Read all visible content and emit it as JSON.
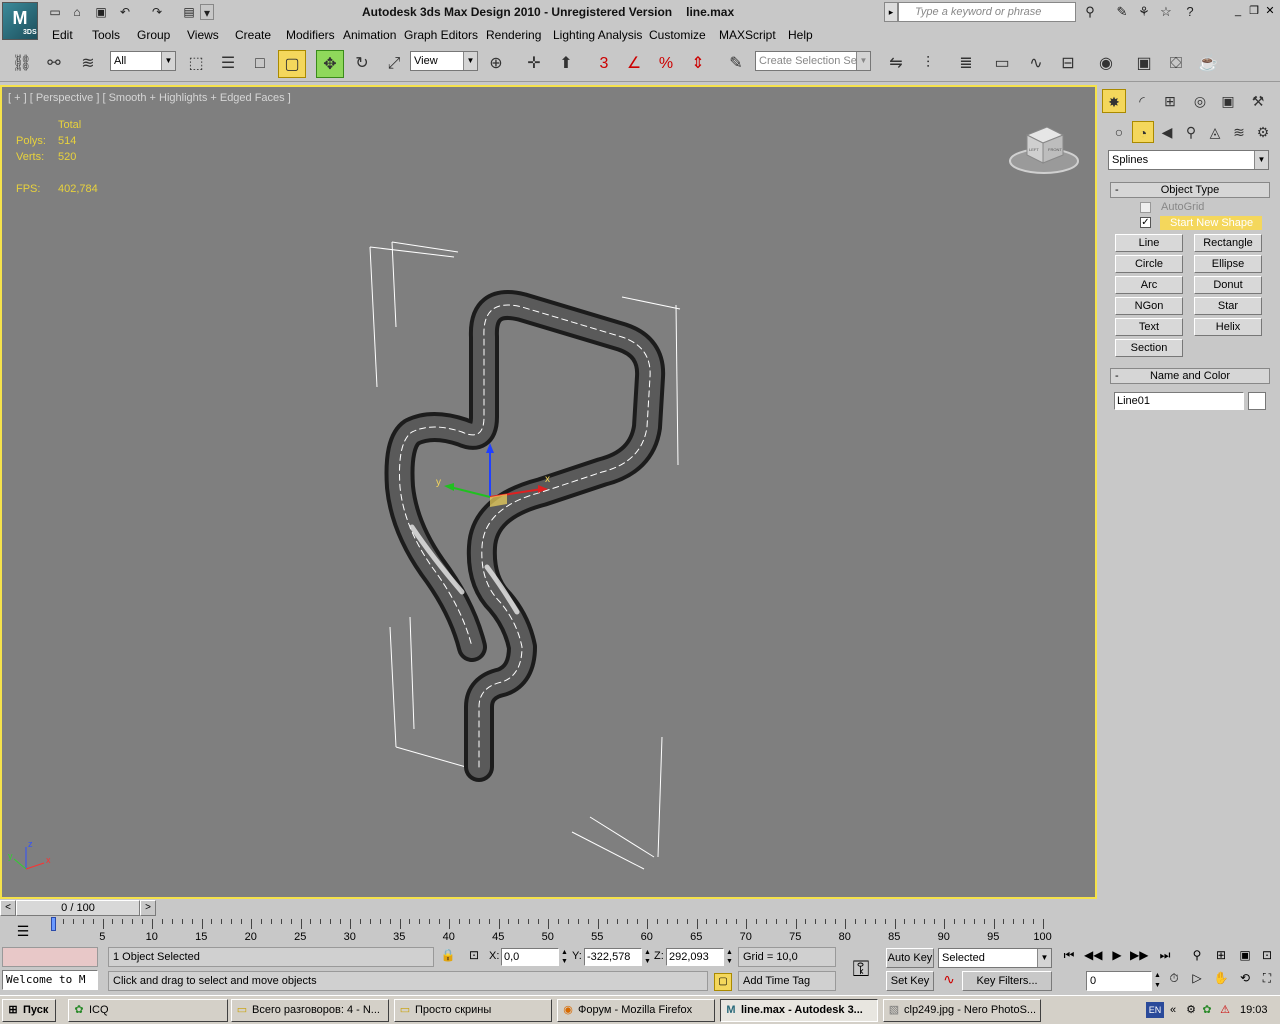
{
  "window": {
    "title": "Autodesk 3ds Max Design 2010 - Unregistered Version",
    "filename": "line.max",
    "search_placeholder": "Type a keyword or phrase",
    "logo": "3DS"
  },
  "menu": [
    "Edit",
    "Tools",
    "Group",
    "Views",
    "Create",
    "Modifiers",
    "Animation",
    "Graph Editors",
    "Rendering",
    "Lighting Analysis",
    "Customize",
    "MAXScript",
    "Help"
  ],
  "toolbar": {
    "selection_filter": "All",
    "ref_coord": "View",
    "named_selection_placeholder": "Create Selection Se",
    "snap_label": "3",
    "angle_label": "%"
  },
  "viewport": {
    "label": "[ + ] [ Perspective ] [ Smooth + Highlights + Edged Faces ]",
    "stats_header": "Total",
    "polys_label": "Polys:",
    "polys_value": "514",
    "verts_label": "Verts:",
    "verts_value": "520",
    "fps_label": "FPS:",
    "fps_value": "402,784",
    "axis_x": "x",
    "axis_y": "y",
    "axis_z": "z",
    "viewcube_left": "LEFT",
    "viewcube_front": "FRONT"
  },
  "command_panel": {
    "category": "Splines",
    "object_type_header": "Object Type",
    "autogrid": "AutoGrid",
    "start_new_shape": "Start New Shape",
    "buttons": [
      "Line",
      "Rectangle",
      "Circle",
      "Ellipse",
      "Arc",
      "Donut",
      "NGon",
      "Star",
      "Text",
      "Helix",
      "Section"
    ],
    "name_color_header": "Name and Color",
    "object_name": "Line01",
    "object_color": "#ffffff"
  },
  "timeline": {
    "frame_label": "0 / 100",
    "ticks": [
      "0",
      "5",
      "10",
      "15",
      "20",
      "25",
      "30",
      "35",
      "40",
      "45",
      "50",
      "55",
      "60",
      "65",
      "70",
      "75",
      "80",
      "85",
      "90",
      "95",
      "100"
    ]
  },
  "status": {
    "welcome": "Welcome to M",
    "selection": "1 Object Selected",
    "prompt": "Click and drag to select and move objects",
    "x_label": "X:",
    "x_value": "0,0",
    "y_label": "Y:",
    "y_value": "-322,578",
    "z_label": "Z:",
    "z_value": "292,093",
    "grid": "Grid = 10,0",
    "add_time_tag": "Add Time Tag",
    "auto_key": "Auto Key",
    "set_key": "Set Key",
    "key_mode": "Selected",
    "key_filters": "Key Filters...",
    "current_frame": "0"
  },
  "taskbar": {
    "start": "Пуск",
    "items": [
      "ICQ",
      "Всего разговоров: 4 - N...",
      "Просто скрины",
      "Форум - Mozilla Firefox",
      "line.max - Autodesk 3...",
      "clp249.jpg - Nero PhotoS..."
    ],
    "lang": "EN",
    "clock": "19:03"
  },
  "colors": {
    "viewport_bg": "#7f7f7f",
    "viewport_border": "#f5e24a",
    "stats_text": "#e8d23c",
    "active_tool": "#f4d75c"
  }
}
